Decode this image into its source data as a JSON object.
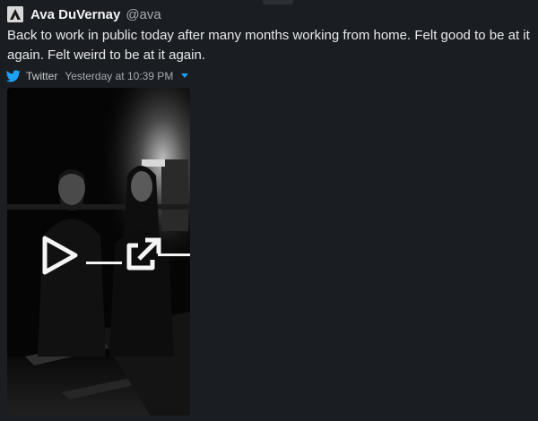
{
  "author": {
    "name": "Ava DuVernay",
    "handle": "@ava",
    "avatar_icon": "ava-logo-icon"
  },
  "tweet": {
    "text": "Back to work in public today after many months working from home. Felt good to be at it again. Felt weird to be at it again."
  },
  "meta": {
    "source_icon": "twitter-bird-icon",
    "source": "Twitter",
    "timestamp": "Yesterday at 10:39 PM",
    "menu_icon": "caret-down-icon"
  },
  "media": {
    "play_icon": "play-icon",
    "open_icon": "open-external-icon"
  },
  "colors": {
    "background": "#1a1d21",
    "text": "#e8e9eb",
    "muted": "#a8abaf",
    "twitter_blue": "#1da1f2"
  }
}
